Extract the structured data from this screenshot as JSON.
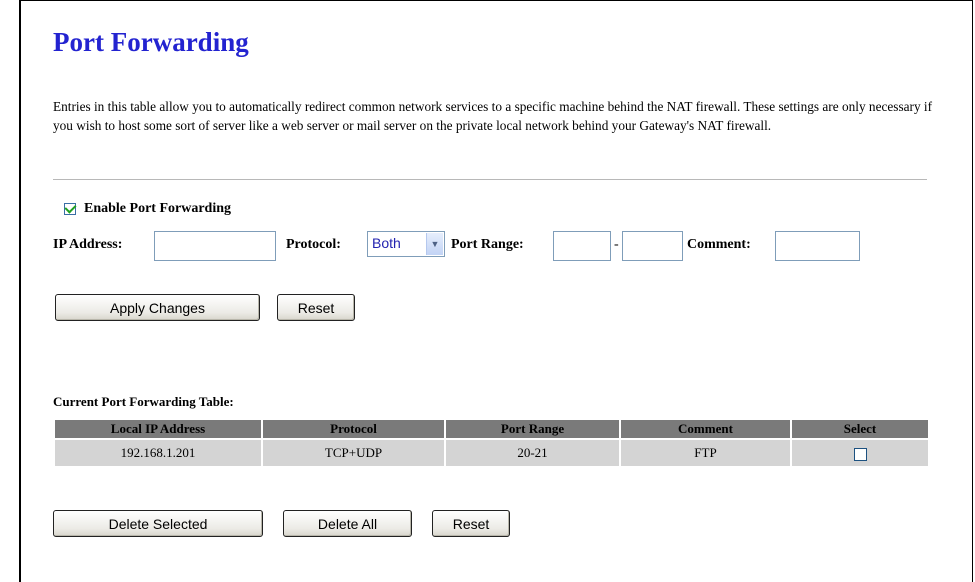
{
  "page": {
    "title": "Port Forwarding",
    "description": "Entries in this table allow you to automatically redirect common network services to a specific machine behind the NAT firewall. These settings are only necessary if you wish to host some sort of server like a web server or mail server on the private local network behind your Gateway's NAT firewall."
  },
  "form": {
    "enable_label": "Enable Port Forwarding",
    "enable_checked": true,
    "ip_label": "IP Address:",
    "ip_value": "",
    "protocol_label": "Protocol:",
    "protocol_value": "Both",
    "port_range_label": "Port Range:",
    "port_from": "",
    "port_separator": "-",
    "port_to": "",
    "comment_label": "Comment:",
    "comment_value": "",
    "apply_label": "Apply Changes",
    "reset_label": "Reset"
  },
  "table": {
    "caption": "Current Port Forwarding Table:",
    "columns": [
      "Local IP Address",
      "Protocol",
      "Port Range",
      "Comment",
      "Select"
    ],
    "rows": [
      {
        "ip": "192.168.1.201",
        "protocol": "TCP+UDP",
        "port_range": "20-21",
        "comment": "FTP",
        "selected": false
      }
    ]
  },
  "actions": {
    "delete_selected_label": "Delete Selected",
    "delete_all_label": "Delete All",
    "reset_label": "Reset"
  }
}
